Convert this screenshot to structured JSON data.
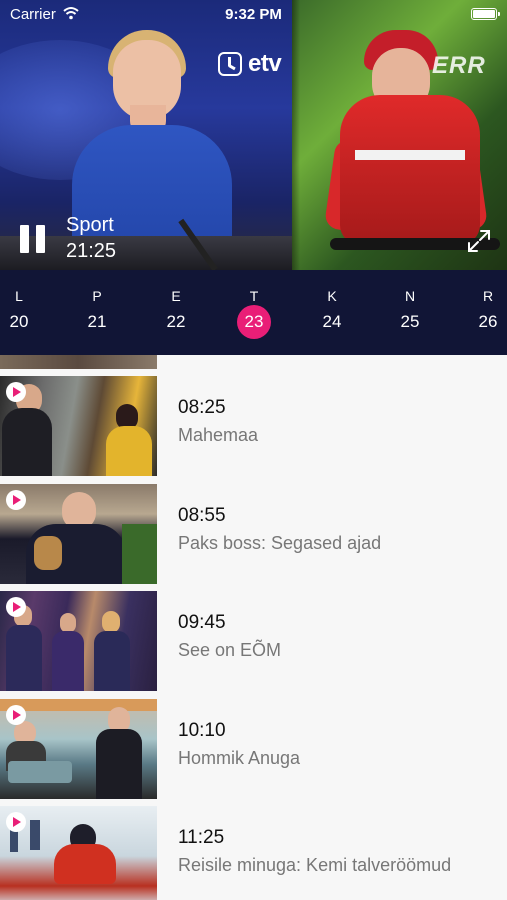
{
  "status_bar": {
    "carrier": "Carrier",
    "time": "9:32 PM"
  },
  "player": {
    "channel_name": "etv",
    "secondary_logo": "ERR",
    "now_title": "Sport",
    "now_time": "21:25",
    "pause_icon": "pause-icon",
    "expand_icon": "expand-icon"
  },
  "dates": [
    {
      "dow": "L",
      "num": "20"
    },
    {
      "dow": "P",
      "num": "21"
    },
    {
      "dow": "E",
      "num": "22"
    },
    {
      "dow": "T",
      "num": "23",
      "selected": true
    },
    {
      "dow": "K",
      "num": "24"
    },
    {
      "dow": "N",
      "num": "25"
    },
    {
      "dow": "R",
      "num": "26"
    }
  ],
  "programs": [
    {
      "time": "08:25",
      "title": "Mahemaa"
    },
    {
      "time": "08:55",
      "title": "Paks boss: Segased ajad"
    },
    {
      "time": "09:45",
      "title": "See on EÕM"
    },
    {
      "time": "10:10",
      "title": "Hommik Anuga"
    },
    {
      "time": "11:25",
      "title": "Reisile minuga: Kemi talveröömud"
    }
  ],
  "colors": {
    "accent": "#e91e77",
    "date_bar": "#111536",
    "list_bg": "#f7f7f7"
  }
}
